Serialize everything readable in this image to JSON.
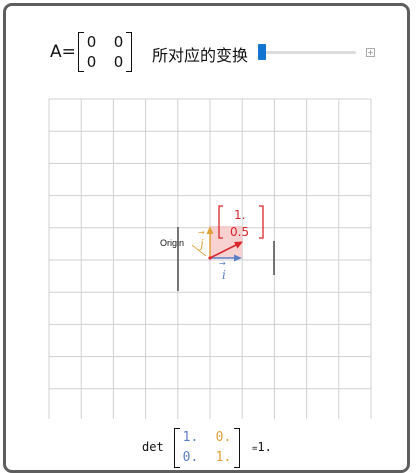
{
  "title_matrix": {
    "label": "A=",
    "cells": [
      "0",
      "0",
      "0",
      "0"
    ]
  },
  "transform_label": "所对应的变换",
  "slider": {
    "value": 0
  },
  "plot": {
    "origin_label": "Origin",
    "i_hat_label": "i",
    "j_hat_label": "j",
    "vector_components": [
      "1.",
      "0.5"
    ],
    "colors": {
      "i_hat": "#5b7fc7",
      "j_hat": "#e0a03a",
      "vector": "#d9262a",
      "grid": "#d0d0d0"
    }
  },
  "det": {
    "label": "det",
    "cells": [
      "1.",
      "0.",
      "0.",
      "1."
    ],
    "equals": "=",
    "result": "1."
  }
}
